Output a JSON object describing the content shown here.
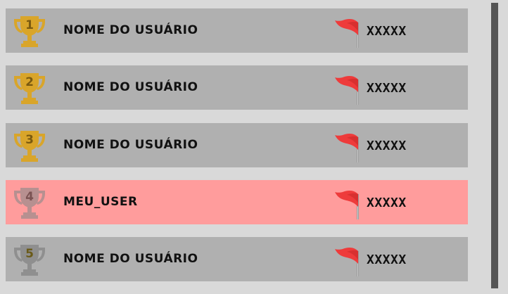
{
  "leaderboard": {
    "rows": [
      {
        "rank": "1",
        "name": "Nome do usuário",
        "score": "XXXXX",
        "highlight": false,
        "trophy_color": "#d9a52a",
        "rank_color": "#7a5a10"
      },
      {
        "rank": "2",
        "name": "Nome do usuário",
        "score": "XXXXX",
        "highlight": false,
        "trophy_color": "#d9a52a",
        "rank_color": "#7a5a10"
      },
      {
        "rank": "3",
        "name": "Nome do usuário",
        "score": "XXXXX",
        "highlight": false,
        "trophy_color": "#d9a52a",
        "rank_color": "#7a5a10"
      },
      {
        "rank": "4",
        "name": "meu_user",
        "score": "XXXXX",
        "highlight": true,
        "trophy_color": "#b79090",
        "rank_color": "#7a5252"
      },
      {
        "rank": "5",
        "name": "Nome do usuário",
        "score": "XXXXX",
        "highlight": false,
        "trophy_color": "#8f8f8f",
        "rank_color": "#6a5a18"
      }
    ],
    "icons": {
      "trophy": "trophy-icon",
      "flag": "flag-icon"
    },
    "colors": {
      "row_background": "#b0b0b0",
      "highlight_background": "#ff9c9c",
      "page_background": "#d9d9d9",
      "scrollbar": "#555555",
      "flag": "#ee3b3b"
    }
  }
}
